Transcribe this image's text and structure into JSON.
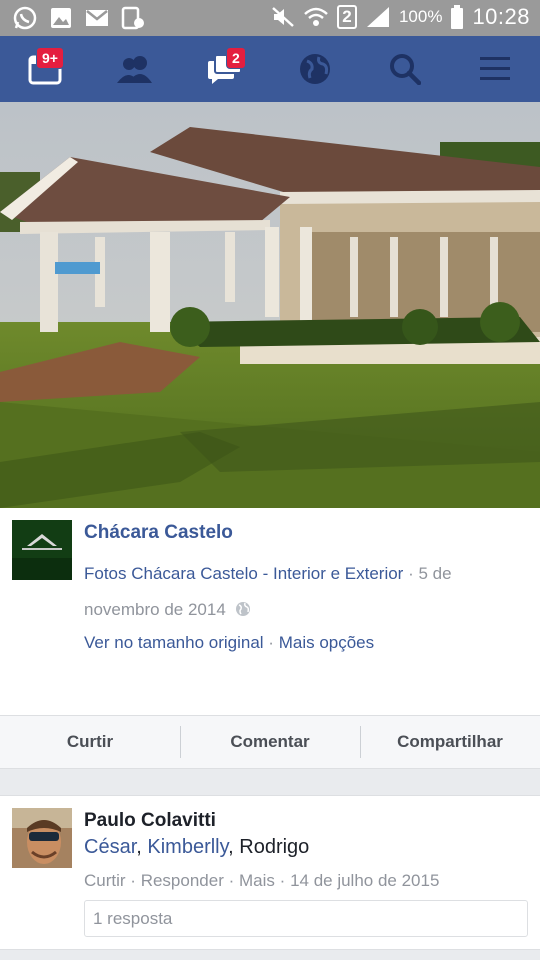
{
  "status_bar": {
    "left_icons": [
      "whatsapp-icon",
      "gallery-icon",
      "gmail-icon",
      "screenshot-icon"
    ],
    "sim_label": "2",
    "battery_percent": "100%",
    "time": "10:28"
  },
  "app_bar": {
    "color": "#3b5998",
    "items": [
      {
        "name": "feed",
        "icon": "news-feed-icon",
        "badge": "9+"
      },
      {
        "name": "friends",
        "icon": "friends-icon",
        "badge": ""
      },
      {
        "name": "messages",
        "icon": "messages-icon",
        "badge": "2"
      },
      {
        "name": "notifications",
        "icon": "globe-icon",
        "badge": ""
      },
      {
        "name": "search",
        "icon": "search-icon",
        "badge": ""
      },
      {
        "name": "menu",
        "icon": "menu-icon",
        "badge": ""
      }
    ]
  },
  "post": {
    "page_name": "Chácara Castelo",
    "album": "Fotos Chácara Castelo - Interior e Exterior",
    "separator": "·",
    "date": "5 de novembro de 2014",
    "view_original": "Ver no tamanho original",
    "more_options": "Mais opções"
  },
  "actions": {
    "like": "Curtir",
    "comment": "Comentar",
    "share": "Compartilhar"
  },
  "comment": {
    "author": "Paulo Colavitti",
    "tags": [
      "César",
      "Kimberlly"
    ],
    "tag_separator": ", ",
    "plain_name": "Rodrigo",
    "like": "Curtir",
    "reply": "Responder",
    "more": "Mais",
    "date": "14 de julho de 2015",
    "replies": "1 resposta"
  }
}
